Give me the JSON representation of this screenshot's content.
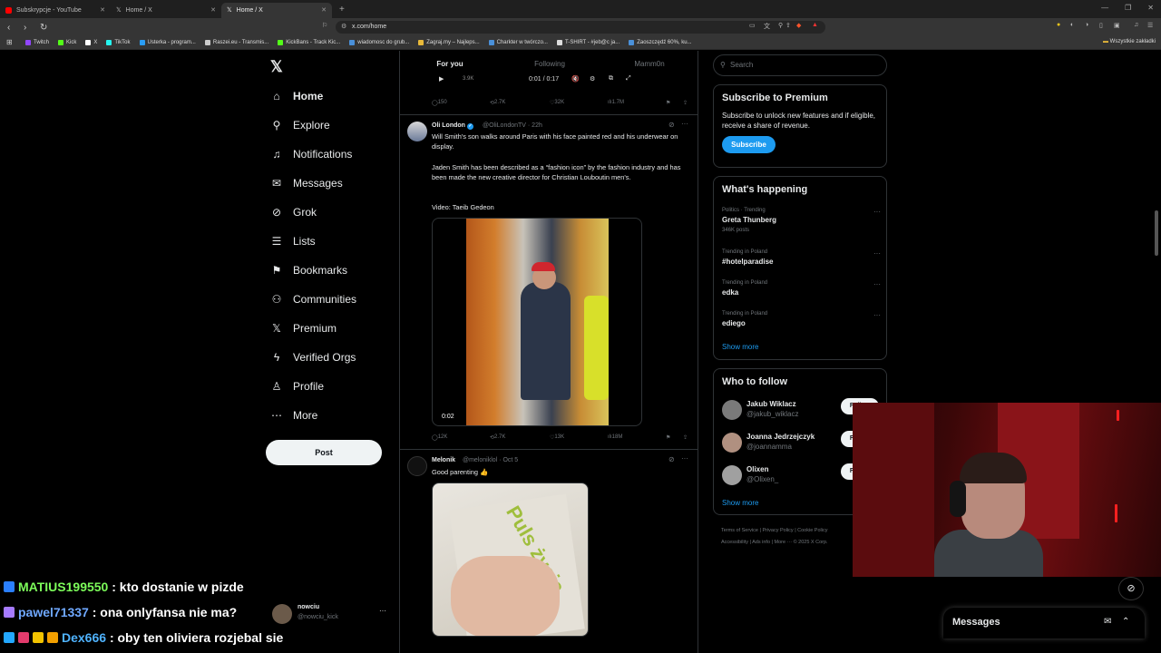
{
  "browser": {
    "tabs": [
      {
        "title": "Subskrypcje - YouTube",
        "color": "#ff0000"
      },
      {
        "title": "Home / X",
        "color": "#ffffff"
      },
      {
        "title": "Home / X",
        "color": "#ffffff"
      }
    ],
    "url": "x.com/home",
    "bookmarks": [
      {
        "label": "Twitch",
        "color": "#9146ff"
      },
      {
        "label": "Kick",
        "color": "#53fc18"
      },
      {
        "label": "X",
        "color": "#ffffff"
      },
      {
        "label": "TikTok",
        "color": "#25f4ee"
      },
      {
        "label": "Usterka - program...",
        "color": "#2a9df4"
      },
      {
        "label": "Raszei.eu - Transmis...",
        "color": "#cccccc"
      },
      {
        "label": "KickBans - Track Kic...",
        "color": "#53fc18"
      },
      {
        "label": "wiadomosc do grub...",
        "color": "#4a90d9"
      },
      {
        "label": "Zagraj.my – Najleps...",
        "color": "#e8b93a"
      },
      {
        "label": "Charkter w twórczo...",
        "color": "#4a90d9"
      },
      {
        "label": "T-SHIRT - #jeb@c ja...",
        "color": "#dddddd"
      },
      {
        "label": "Zaoszczędź 60%, ku...",
        "color": "#4a90d9"
      }
    ],
    "bookmarks_right": "Wszystkie zakładki"
  },
  "nav": {
    "items": [
      {
        "label": "Home",
        "icon": "home-icon",
        "glyph": "⌂"
      },
      {
        "label": "Explore",
        "icon": "search-icon",
        "glyph": "⚲"
      },
      {
        "label": "Notifications",
        "icon": "bell-icon",
        "glyph": "♫"
      },
      {
        "label": "Messages",
        "icon": "mail-icon",
        "glyph": "✉"
      },
      {
        "label": "Grok",
        "icon": "grok-icon",
        "glyph": "⊘"
      },
      {
        "label": "Lists",
        "icon": "list-icon",
        "glyph": "☰"
      },
      {
        "label": "Bookmarks",
        "icon": "bookmark-icon",
        "glyph": "⚑"
      },
      {
        "label": "Communities",
        "icon": "communities-icon",
        "glyph": "⚇"
      },
      {
        "label": "Premium",
        "icon": "x-premium-icon",
        "glyph": "𝕏"
      },
      {
        "label": "Verified Orgs",
        "icon": "lightning-icon",
        "glyph": "ϟ"
      },
      {
        "label": "Profile",
        "icon": "person-icon",
        "glyph": "♙"
      },
      {
        "label": "More",
        "icon": "more-circle-icon",
        "glyph": "⋯"
      }
    ],
    "post_label": "Post",
    "account": {
      "name": "nowciu",
      "handle": "@nowciu_kick"
    }
  },
  "feed": {
    "tabs": [
      "For you",
      "Following",
      "Mamm0n"
    ],
    "prev_tweet": {
      "time": "0:01 / 0:17",
      "views_small": "3.9K",
      "replies": "150",
      "reposts": "2.7K",
      "likes": "32K",
      "views": "1.7M"
    },
    "tweet1": {
      "name": "Oli London",
      "handle": "@OliLondonTV · 22h",
      "text1": "Will Smith's son walks around Paris with his face painted red and his underwear on display.",
      "text2": "Jaden Smith has been described as a “fashion icon” by the fashion industry and has been made the new creative director for Christian Louboutin men's.",
      "text3": "Video: Taeib Gedeon",
      "video_time": "0:02",
      "replies": "12K",
      "reposts": "2.7K",
      "likes": "13K",
      "views": "18M"
    },
    "tweet2": {
      "name": "Melonik",
      "handle": "@meloniklol · Oct 5",
      "text": "Good parenting 👍",
      "photo_text": "Puls życia"
    }
  },
  "sidebar": {
    "search_placeholder": "Search",
    "premium": {
      "title": "Subscribe to Premium",
      "text": "Subscribe to unlock new features and if eligible, receive a share of revenue.",
      "button": "Subscribe"
    },
    "happening": {
      "title": "What's happening",
      "trends": [
        {
          "context": "Politics · Trending",
          "title": "Greta Thunberg",
          "count": "346K posts"
        },
        {
          "context": "Trending in Poland",
          "title": "#hotelparadise",
          "count": ""
        },
        {
          "context": "Trending in Poland",
          "title": "edka",
          "count": ""
        },
        {
          "context": "Trending in Poland",
          "title": "ediego",
          "count": ""
        }
      ],
      "show_more": "Show more"
    },
    "follow": {
      "title": "Who to follow",
      "people": [
        {
          "name": "Jakub Wiklacz",
          "handle": "@jakub_wiklacz",
          "button": "Follow"
        },
        {
          "name": "Joanna Jedrzejczyk",
          "handle": "@joannamma",
          "button": "Follow"
        },
        {
          "name": "Olixen",
          "handle": "@Olixen_",
          "button": "Follow"
        }
      ],
      "show_more": "Show more"
    },
    "footer": {
      "line1": "Terms of Service  |  Privacy Policy  |  Cookie Policy",
      "line2": "Accessibility  |  Ads info  |  More ···  © 2025 X Corp."
    }
  },
  "messages_bar": {
    "title": "Messages"
  },
  "chat": [
    {
      "user": "MATIUS199550",
      "message": ": kto dostanie w pizde",
      "color": "#7cfc5a",
      "badges": [
        "#2a7fff"
      ]
    },
    {
      "user": "pawel71337",
      "message": ": ona onlyfansa nie ma?",
      "color": "#6fa8ff",
      "badges": [
        "#a67bff"
      ]
    },
    {
      "user": "Dex666",
      "message": ": oby ten oliviera rozjebal sie",
      "color": "#4fb3ff",
      "badges": [
        "#23a8ff",
        "#e23b6c",
        "#f2c300",
        "#f2a000"
      ]
    }
  ]
}
